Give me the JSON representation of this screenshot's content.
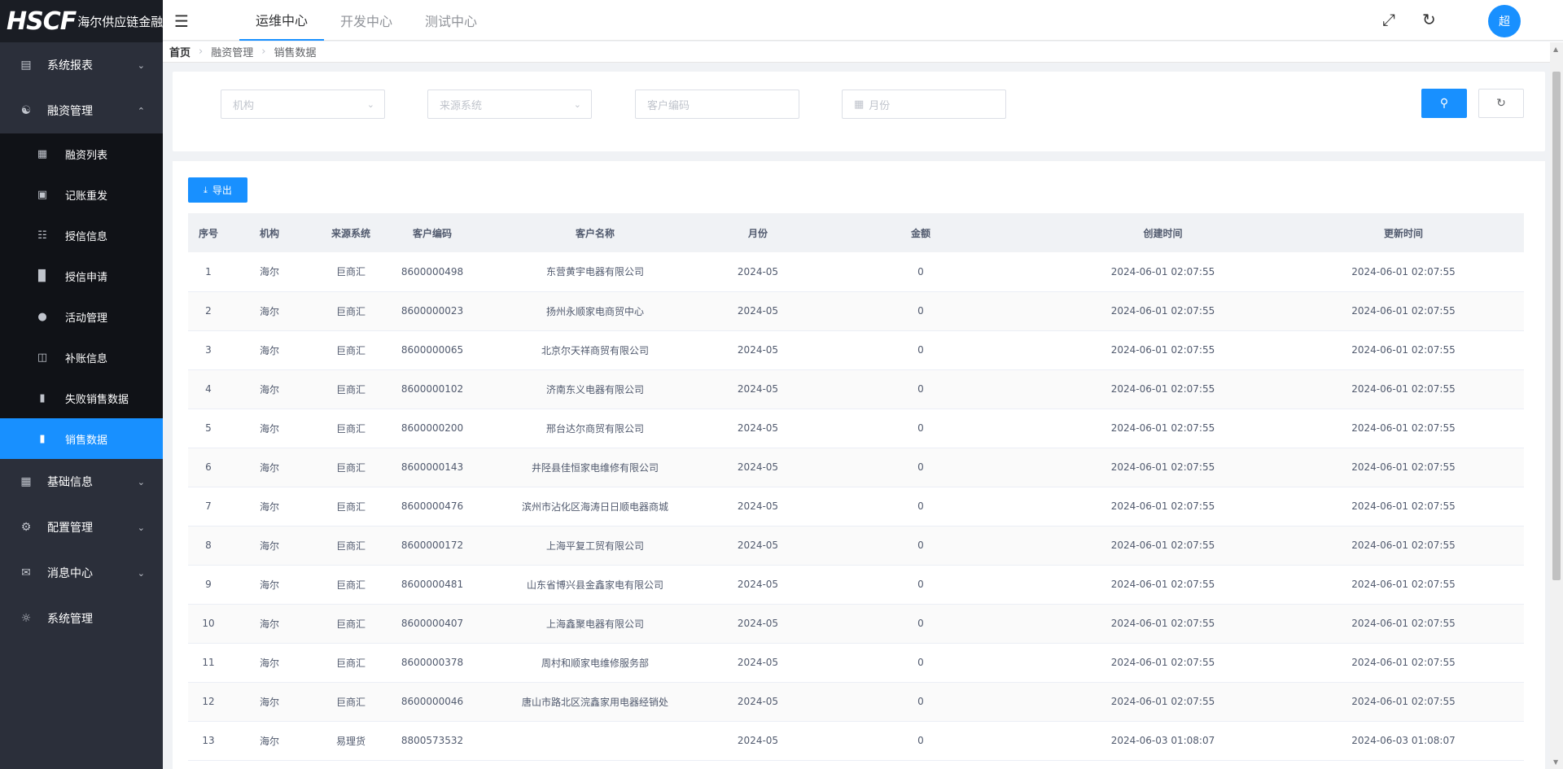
{
  "brand": {
    "mark": "HSCF",
    "name": "海尔供应链金融平台"
  },
  "sidebar": {
    "items": [
      {
        "label": "系统报表",
        "icon": "chart-icon",
        "expanded": false
      },
      {
        "label": "融资管理",
        "icon": "database-icon",
        "expanded": true
      },
      {
        "label": "基础信息",
        "icon": "grid-icon",
        "expanded": false
      },
      {
        "label": "配置管理",
        "icon": "gear-icon",
        "expanded": false
      },
      {
        "label": "消息中心",
        "icon": "mail-icon",
        "expanded": false
      },
      {
        "label": "系统管理",
        "icon": "settings-icon",
        "expanded": false
      }
    ],
    "submenu": [
      {
        "label": "融资列表",
        "icon": "list-icon"
      },
      {
        "label": "记账重发",
        "icon": "lock-icon"
      },
      {
        "label": "授信信息",
        "icon": "doc-icon"
      },
      {
        "label": "授信申请",
        "icon": "monitor-icon"
      },
      {
        "label": "活动管理",
        "icon": "bulb-icon"
      },
      {
        "label": "补账信息",
        "icon": "folder-icon"
      },
      {
        "label": "失败销售数据",
        "icon": "clipboard-icon"
      },
      {
        "label": "销售数据",
        "icon": "clipboard-icon",
        "active": true
      }
    ]
  },
  "header": {
    "tabs": [
      "运维中心",
      "开发中心",
      "测试中心"
    ],
    "active_tab": 0,
    "avatar": "超"
  },
  "breadcrumb": [
    "首页",
    "融资管理",
    "销售数据"
  ],
  "filters": {
    "org_placeholder": "机构",
    "source_placeholder": "来源系统",
    "customer_code_placeholder": "客户编码",
    "month_placeholder": "月份"
  },
  "toolbar": {
    "export_label": "导出"
  },
  "table": {
    "columns": [
      "序号",
      "机构",
      "来源系统",
      "客户编码",
      "客户名称",
      "月份",
      "金额",
      "创建时间",
      "更新时间"
    ],
    "rows": [
      [
        "1",
        "海尔",
        "巨商汇",
        "8600000498",
        "东营黄宇电器有限公司",
        "2024-05",
        "0",
        "2024-06-01 02:07:55",
        "2024-06-01 02:07:55"
      ],
      [
        "2",
        "海尔",
        "巨商汇",
        "8600000023",
        "扬州永顺家电商贸中心",
        "2024-05",
        "0",
        "2024-06-01 02:07:55",
        "2024-06-01 02:07:55"
      ],
      [
        "3",
        "海尔",
        "巨商汇",
        "8600000065",
        "北京尔天祥商贸有限公司",
        "2024-05",
        "0",
        "2024-06-01 02:07:55",
        "2024-06-01 02:07:55"
      ],
      [
        "4",
        "海尔",
        "巨商汇",
        "8600000102",
        "济南东义电器有限公司",
        "2024-05",
        "0",
        "2024-06-01 02:07:55",
        "2024-06-01 02:07:55"
      ],
      [
        "5",
        "海尔",
        "巨商汇",
        "8600000200",
        "邢台达尔商贸有限公司",
        "2024-05",
        "0",
        "2024-06-01 02:07:55",
        "2024-06-01 02:07:55"
      ],
      [
        "6",
        "海尔",
        "巨商汇",
        "8600000143",
        "井陉县佳恒家电维修有限公司",
        "2024-05",
        "0",
        "2024-06-01 02:07:55",
        "2024-06-01 02:07:55"
      ],
      [
        "7",
        "海尔",
        "巨商汇",
        "8600000476",
        "滨州市沾化区海涛日日顺电器商城",
        "2024-05",
        "0",
        "2024-06-01 02:07:55",
        "2024-06-01 02:07:55"
      ],
      [
        "8",
        "海尔",
        "巨商汇",
        "8600000172",
        "上海平复工贸有限公司",
        "2024-05",
        "0",
        "2024-06-01 02:07:55",
        "2024-06-01 02:07:55"
      ],
      [
        "9",
        "海尔",
        "巨商汇",
        "8600000481",
        "山东省博兴县金鑫家电有限公司",
        "2024-05",
        "0",
        "2024-06-01 02:07:55",
        "2024-06-01 02:07:55"
      ],
      [
        "10",
        "海尔",
        "巨商汇",
        "8600000407",
        "上海鑫聚电器有限公司",
        "2024-05",
        "0",
        "2024-06-01 02:07:55",
        "2024-06-01 02:07:55"
      ],
      [
        "11",
        "海尔",
        "巨商汇",
        "8600000378",
        "周村和顺家电维修服务部",
        "2024-05",
        "0",
        "2024-06-01 02:07:55",
        "2024-06-01 02:07:55"
      ],
      [
        "12",
        "海尔",
        "巨商汇",
        "8600000046",
        "唐山市路北区浣鑫家用电器经销处",
        "2024-05",
        "0",
        "2024-06-01 02:07:55",
        "2024-06-01 02:07:55"
      ],
      [
        "13",
        "海尔",
        "易理货",
        "8800573532",
        "",
        "2024-05",
        "0",
        "2024-06-03 01:08:07",
        "2024-06-03 01:08:07"
      ]
    ]
  },
  "colors": {
    "primary": "#1890ff",
    "sidebar_bg": "#2b2f3a",
    "submenu_bg": "#101217"
  }
}
